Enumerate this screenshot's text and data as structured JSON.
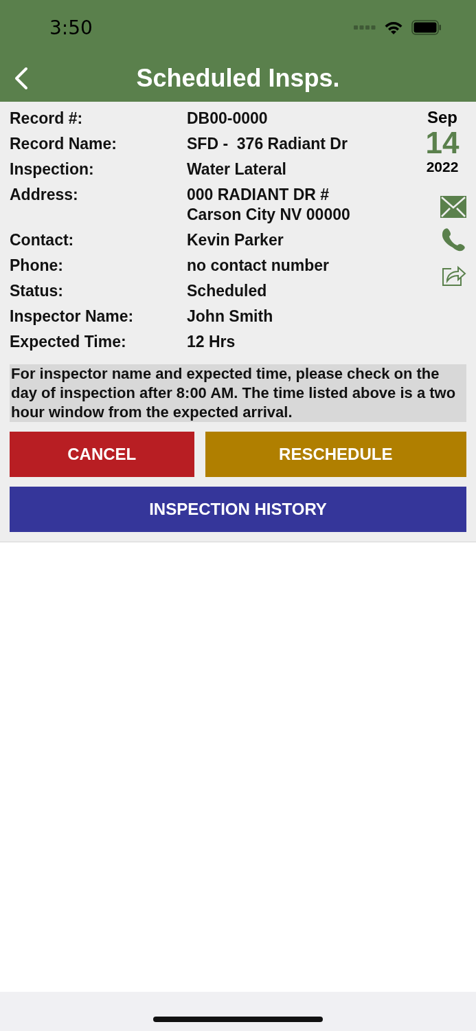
{
  "status_bar": {
    "time": "3:50"
  },
  "nav": {
    "title": "Scheduled Insps."
  },
  "details": [
    {
      "label": "Record #:",
      "value": "DB00-0000"
    },
    {
      "label": "Record Name:",
      "value": "SFD -  376 Radiant Dr"
    },
    {
      "label": "Inspection:",
      "value": "Water Lateral"
    },
    {
      "label": "Address:",
      "value": "000 RADIANT DR #\nCarson City NV 00000"
    },
    {
      "label": "Contact:",
      "value": "Kevin Parker"
    },
    {
      "label": "Phone:",
      "value": "no contact number"
    },
    {
      "label": "Status:",
      "value": "Scheduled"
    },
    {
      "label": "Inspector Name:",
      "value": "John Smith"
    },
    {
      "label": "Expected Time:",
      "value": "12 Hrs"
    }
  ],
  "date": {
    "month": "Sep",
    "day": "14",
    "year": "2022"
  },
  "note": "For inspector name and expected time, please check on the day of inspection after 8:00 AM. The time listed above is a two hour window from the expected arrival.",
  "buttons": [
    {
      "label": "CANCEL",
      "kind": "cancel"
    },
    {
      "label": "RESCHEDULE",
      "kind": "reschedule"
    },
    {
      "label": "INSPECTION HISTORY",
      "kind": "history"
    }
  ]
}
